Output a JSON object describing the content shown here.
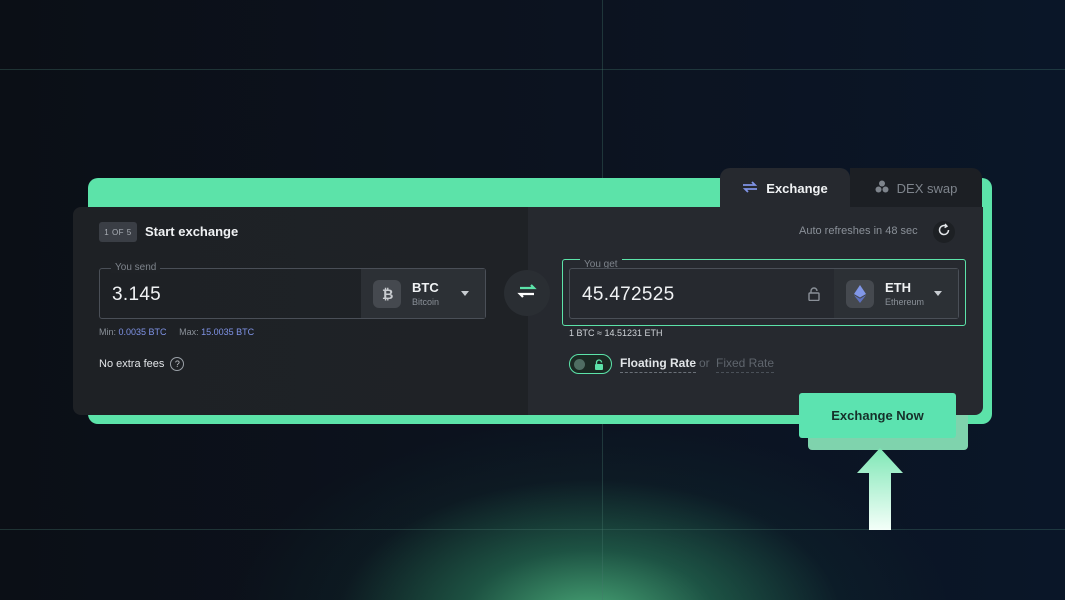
{
  "tabs": [
    {
      "label": "Exchange",
      "icon": "exchange-arrows-icon",
      "active": true
    },
    {
      "label": "DEX swap",
      "icon": "dex-dots-icon",
      "active": false
    }
  ],
  "header": {
    "step_badge": "1 OF 5",
    "title": "Start exchange",
    "auto_refresh": "Auto refreshes in 48 sec"
  },
  "send": {
    "label": "You send",
    "amount": "3.145",
    "ticker": "BTC",
    "coin_name": "Bitcoin",
    "min_label": "Min:",
    "min_value": "0.0035 BTC",
    "max_label": "Max:",
    "max_value": "15.0035 BTC"
  },
  "get": {
    "label": "You get",
    "amount": "45.472525",
    "ticker": "ETH",
    "coin_name": "Ethereum",
    "rate": "1 BTC ≈ 14.51231 ETH"
  },
  "fees": {
    "label": "No extra fees",
    "help": "?"
  },
  "rate_type": {
    "floating": "Floating Rate",
    "or": "or",
    "fixed": "Fixed Rate"
  },
  "action": {
    "label": "Exchange Now"
  },
  "colors": {
    "accent": "#5ce3a9",
    "card_left": "#1f2226",
    "card_right": "#26292f",
    "minmax_value": "#7f93e6"
  }
}
